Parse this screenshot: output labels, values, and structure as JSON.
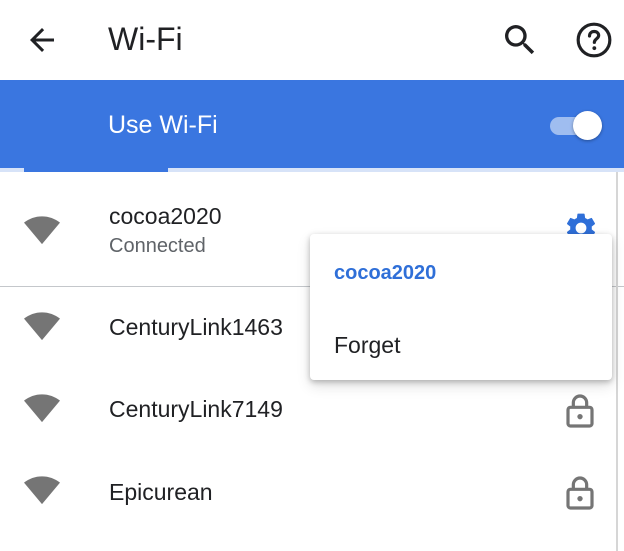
{
  "app_bar": {
    "title": "Wi-Fi",
    "icons": {
      "back": "arrow-back-icon",
      "search": "search-icon",
      "help": "help-icon"
    }
  },
  "use_wifi": {
    "label": "Use Wi-Fi",
    "enabled": true
  },
  "networks": [
    {
      "name": "cocoa2020",
      "status": "Connected",
      "trailing_icon": "settings-gear-icon"
    },
    {
      "name": "CenturyLink1463",
      "status": "",
      "trailing_icon": "lock-icon"
    },
    {
      "name": "CenturyLink7149",
      "status": "",
      "trailing_icon": "lock-icon"
    },
    {
      "name": "Epicurean",
      "status": "",
      "trailing_icon": "lock-icon"
    }
  ],
  "context_menu": {
    "title": "cocoa2020",
    "items": [
      "Forget"
    ]
  },
  "colors": {
    "accent": "#3a76e0",
    "accent_text": "#2f6fd8",
    "icon_gray": "#757575",
    "text_primary": "#202124",
    "text_secondary": "#5f6368"
  }
}
